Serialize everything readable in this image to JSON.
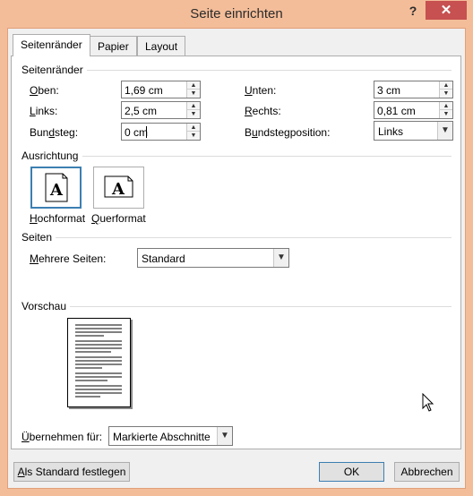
{
  "window": {
    "title": "Seite einrichten",
    "help": "?",
    "close": "✕"
  },
  "tabs": [
    {
      "label": "Seitenränder",
      "active": true
    },
    {
      "label": "Papier",
      "active": false
    },
    {
      "label": "Layout",
      "active": false
    }
  ],
  "margins": {
    "group": "Seitenränder",
    "top_prefix": "O",
    "top_rest": "ben:",
    "top_value": "1,69 cm",
    "left_prefix": "L",
    "left_rest": "inks:",
    "left_value": "2,5 cm",
    "gutter_pre": "Bun",
    "gutter_key": "d",
    "gutter_post": "steg:",
    "gutter_value": "0 cm",
    "bottom_prefix": "U",
    "bottom_rest": "nten:",
    "bottom_value": "3 cm",
    "right_prefix": "R",
    "right_rest": "echts:",
    "right_value": "0,81 cm",
    "gutterpos_pre": "B",
    "gutterpos_key": "u",
    "gutterpos_post": "ndstegposition:",
    "gutterpos_value": "Links"
  },
  "orientation": {
    "group": "Ausrichtung",
    "portrait_key": "H",
    "portrait_rest": "ochformat",
    "portrait_glyph": "A",
    "landscape_key": "Q",
    "landscape_rest": "uerformat",
    "landscape_glyph": "A",
    "selected": "portrait"
  },
  "pages": {
    "group": "Seiten",
    "multiple_key": "M",
    "multiple_rest": "ehrere Seiten:",
    "multiple_value": "Standard"
  },
  "preview": {
    "group": "Vorschau"
  },
  "apply": {
    "key": "Ü",
    "rest": "bernehmen für:",
    "value": "Markierte Abschnitte"
  },
  "buttons": {
    "set_default_key": "A",
    "set_default_rest": "ls Standard festlegen",
    "ok": "OK",
    "cancel": "Abbrechen"
  },
  "colors": {
    "titlebar": "#f3bd99",
    "close": "#c75050",
    "selection": "#3c7fb1"
  },
  "icons": {
    "spin_up": "▲",
    "spin_down": "▼",
    "dropdown": "▼"
  }
}
